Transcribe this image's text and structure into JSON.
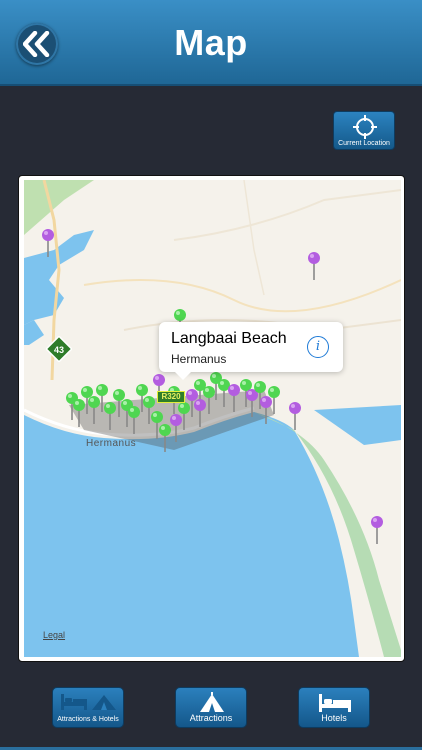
{
  "header": {
    "title": "Map",
    "back_icon": "double-chevron-left-icon"
  },
  "current_location": {
    "label": "Current Location",
    "icon": "crosshair-icon"
  },
  "map": {
    "callout": {
      "title": "Langbaai Beach",
      "subtitle": "Hermanus",
      "icon": "info-icon"
    },
    "legal_label": "Legal",
    "town_label": "Hermanus",
    "route_badges": [
      "43",
      "R320"
    ],
    "pin_colors": {
      "attraction": "#b35de0",
      "hotel": "#4fd651"
    }
  },
  "tabs": [
    {
      "label": "Attractions & Hotels",
      "icon": "bed-tent-icon"
    },
    {
      "label": "Attractions",
      "icon": "tent-icon"
    },
    {
      "label": "Hotels",
      "icon": "bed-icon"
    }
  ],
  "colors": {
    "header": "#2a7cb5",
    "background": "#262a35",
    "water": "#7dc3ee",
    "land": "#f5f2eb"
  }
}
